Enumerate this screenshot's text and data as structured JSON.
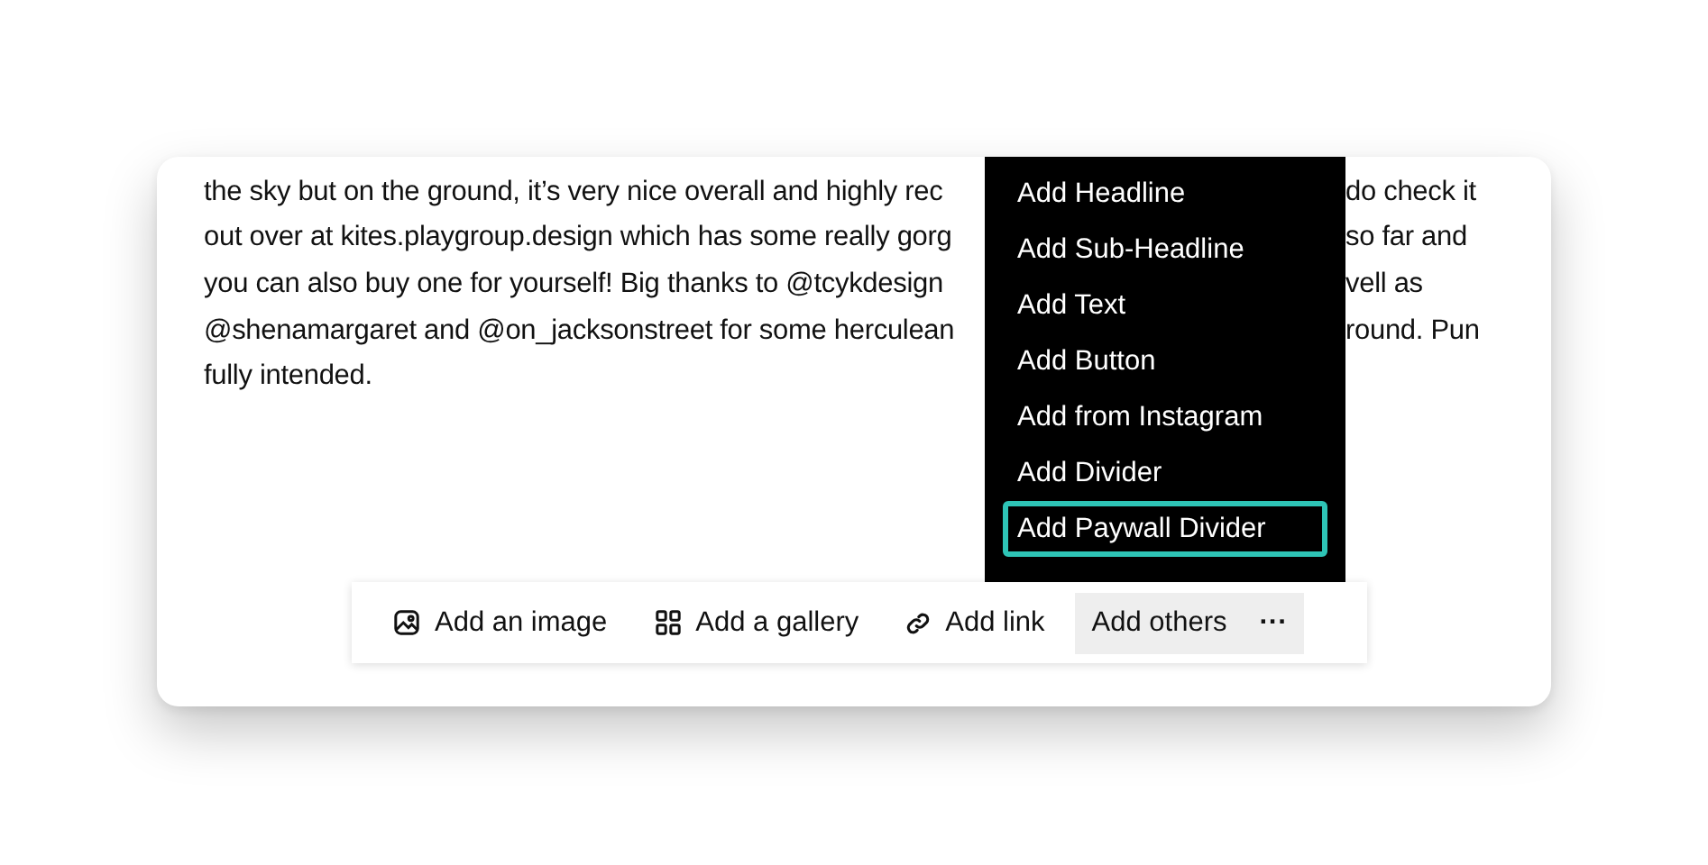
{
  "article": {
    "lines": [
      {
        "left": "the sky but on the ground, it’s very nice overall and highly rec",
        "right": "do check it"
      },
      {
        "left": "out over at kites.playgroup.design which has some really gorg",
        "right": "so far and"
      },
      {
        "left": "you can also buy one for yourself! Big thanks to @tcykdesign",
        "right": "vell as"
      },
      {
        "left": "@shenamargaret and @on_jacksonstreet for some herculean",
        "right": "round. Pun"
      },
      {
        "left": "fully intended."
      }
    ]
  },
  "menu": {
    "items": [
      {
        "label": "Add Headline",
        "selected": false
      },
      {
        "label": "Add Sub-Headline",
        "selected": false
      },
      {
        "label": "Add Text",
        "selected": false
      },
      {
        "label": "Add Button",
        "selected": false
      },
      {
        "label": "Add from Instagram",
        "selected": false
      },
      {
        "label": "Add Divider",
        "selected": false
      },
      {
        "label": "Add Paywall Divider",
        "selected": true
      }
    ]
  },
  "toolbar": {
    "items": [
      {
        "kind": "image",
        "label": "Add an image"
      },
      {
        "kind": "gallery",
        "label": "Add a gallery"
      },
      {
        "kind": "link",
        "label": "Add link"
      },
      {
        "kind": "more",
        "label": "Add others",
        "expanded": true,
        "symbol": "···"
      }
    ]
  }
}
